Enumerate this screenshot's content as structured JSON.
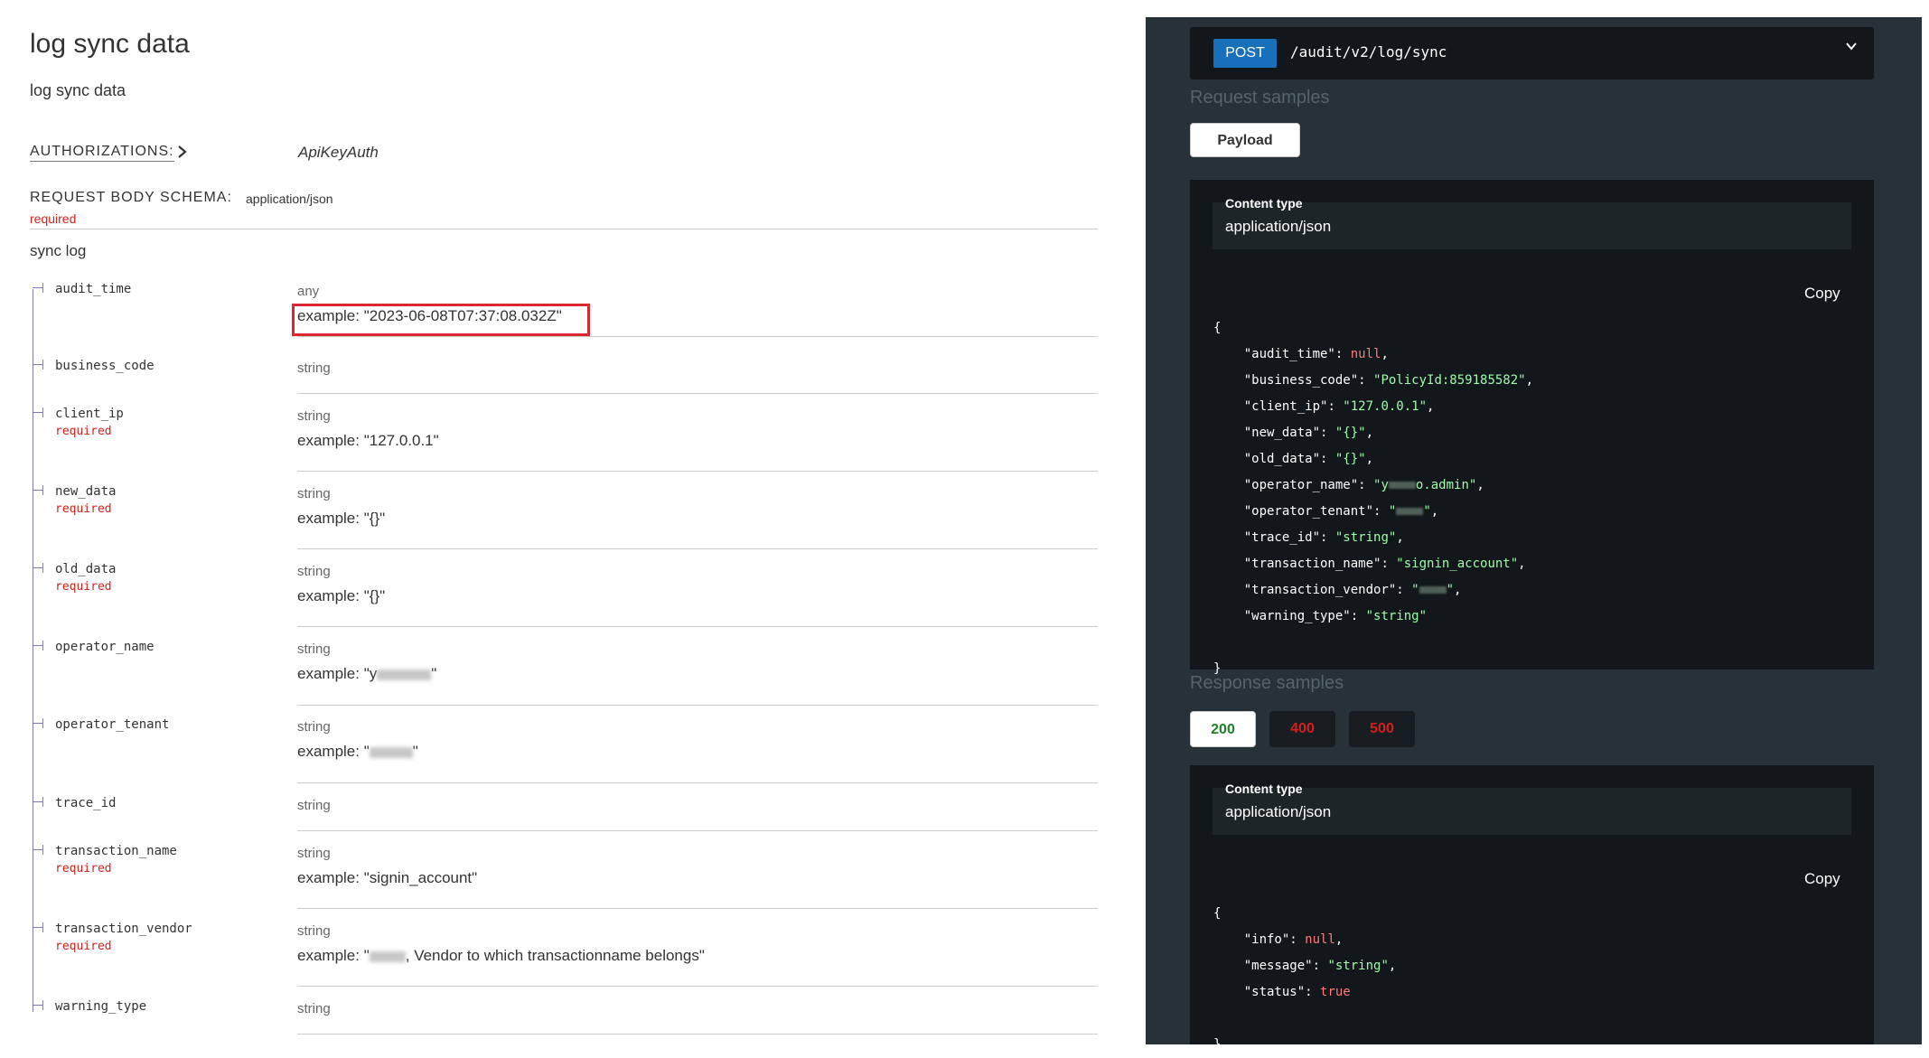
{
  "operation": {
    "title": "log sync data",
    "description": "log sync data",
    "authorizations_label": "AUTHORIZATIONS:",
    "authorizations_value": "ApiKeyAuth",
    "request_body_label": "REQUEST BODY SCHEMA:",
    "request_body_content_type": "application/json",
    "request_body_required": "required",
    "body_description": "sync log"
  },
  "properties": [
    {
      "name": "audit_time",
      "required": "",
      "type": "any",
      "example": "example: \"2023-06-08T07:37:08.032Z\""
    },
    {
      "name": "business_code",
      "required": "",
      "type": "string",
      "example": ""
    },
    {
      "name": "client_ip",
      "required": "required",
      "type": "string",
      "example": "example: \"127.0.0.1\""
    },
    {
      "name": "new_data",
      "required": "required",
      "type": "string",
      "example": "example: \"{}\""
    },
    {
      "name": "old_data",
      "required": "required",
      "type": "string",
      "example": "example: \"{}\""
    },
    {
      "name": "operator_name",
      "required": "",
      "type": "string",
      "example": "example: \"y"
    },
    {
      "name": "operator_tenant",
      "required": "",
      "type": "string",
      "example": "example: \""
    },
    {
      "name": "trace_id",
      "required": "",
      "type": "string",
      "example": ""
    },
    {
      "name": "transaction_name",
      "required": "required",
      "type": "string",
      "example": "example: \"signin_account\""
    },
    {
      "name": "transaction_vendor",
      "required": "required",
      "type": "string",
      "example": "example: \""
    },
    {
      "name": "warning_type",
      "required": "",
      "type": "string",
      "example": ""
    }
  ],
  "examples_extra": {
    "operator_name_tail": "\"",
    "operator_tenant_tail": "\"",
    "transaction_vendor_tail": ", Vendor to which transactionname belongs\""
  },
  "endpoint": {
    "method": "POST",
    "path": "/audit/v2/log/sync"
  },
  "request_samples": {
    "title": "Request samples",
    "tab": "Payload",
    "content_type_label": "Content type",
    "content_type": "application/json",
    "copy": "Copy"
  },
  "request_json": {
    "open": "{",
    "close": "}",
    "lines": [
      {
        "key": "\"audit_time\"",
        "value": "null",
        "kind": "n",
        "comma": ","
      },
      {
        "key": "\"business_code\"",
        "value": "\"PolicyId:859185582\"",
        "kind": "s",
        "comma": ","
      },
      {
        "key": "\"client_ip\"",
        "value": "\"127.0.0.1\"",
        "kind": "s",
        "comma": ","
      },
      {
        "key": "\"new_data\"",
        "value": "\"{}\"",
        "kind": "s",
        "comma": ","
      },
      {
        "key": "\"old_data\"",
        "value": "\"{}\"",
        "kind": "s",
        "comma": ","
      },
      {
        "key": "\"operator_name\"",
        "value": "\"y",
        "kind": "s",
        "comma": ","
      },
      {
        "key": "\"operator_tenant\"",
        "value": "\"",
        "kind": "s",
        "comma": ","
      },
      {
        "key": "\"trace_id\"",
        "value": "\"string\"",
        "kind": "s",
        "comma": ","
      },
      {
        "key": "\"transaction_name\"",
        "value": "\"signin_account\"",
        "kind": "s",
        "comma": ","
      },
      {
        "key": "\"transaction_vendor\"",
        "value": "\"",
        "kind": "s",
        "comma": ","
      },
      {
        "key": "\"warning_type\"",
        "value": "\"string\"",
        "kind": "s",
        "comma": ""
      }
    ],
    "operator_name_tail": "o.admin\"",
    "masked_tail": "\""
  },
  "response_samples": {
    "title": "Response samples",
    "tabs": [
      "200",
      "400",
      "500"
    ],
    "content_type_label": "Content type",
    "content_type": "application/json",
    "copy": "Copy"
  },
  "response_json": {
    "open": "{",
    "close": "}",
    "lines": [
      {
        "key": "\"info\"",
        "value": "null",
        "kind": "n",
        "comma": ","
      },
      {
        "key": "\"message\"",
        "value": "\"string\"",
        "kind": "s",
        "comma": ","
      },
      {
        "key": "\"status\"",
        "value": "true",
        "kind": "n",
        "comma": ""
      }
    ]
  },
  "colors": {
    "method_post": "#186fba",
    "required": "#d41f1c",
    "highlight_box": "#d9282f",
    "panel_bg": "#263238",
    "code_string": "#a0fbaa",
    "code_literal": "#ff7a7a",
    "status_ok": "#1d8127",
    "status_error": "#d41f1c"
  }
}
